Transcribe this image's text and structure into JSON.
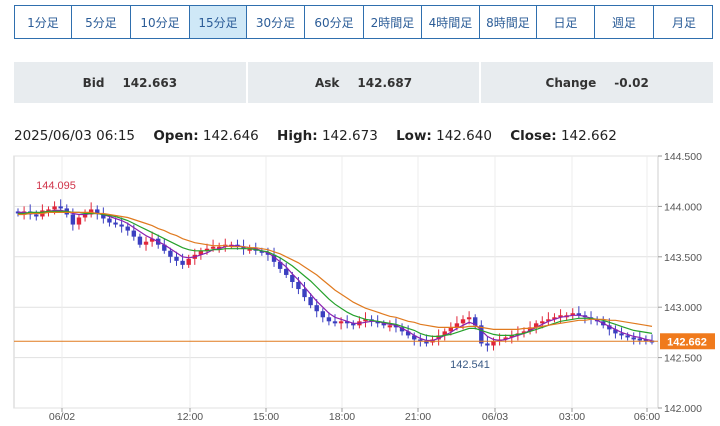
{
  "timeframe_tabs": [
    {
      "label": "1分足",
      "active": false
    },
    {
      "label": "5分足",
      "active": false
    },
    {
      "label": "10分足",
      "active": false
    },
    {
      "label": "15分足",
      "active": true
    },
    {
      "label": "30分足",
      "active": false
    },
    {
      "label": "60分足",
      "active": false
    },
    {
      "label": "2時間足",
      "active": false
    },
    {
      "label": "4時間足",
      "active": false
    },
    {
      "label": "8時間足",
      "active": false
    },
    {
      "label": "日足",
      "active": false
    },
    {
      "label": "週足",
      "active": false
    },
    {
      "label": "月足",
      "active": false
    }
  ],
  "quote": {
    "bid_label": "Bid",
    "bid_value": "142.663",
    "ask_label": "Ask",
    "ask_value": "142.687",
    "change_label": "Change",
    "change_value": "-0.02"
  },
  "ohlc": {
    "timestamp": "2025/06/03 06:15",
    "open_label": "Open:",
    "open_value": "142.646",
    "high_label": "High:",
    "high_value": "142.673",
    "low_label": "Low:",
    "low_value": "142.640",
    "close_label": "Close:",
    "close_value": "142.662"
  },
  "colors": {
    "tab_border": "#2f6fae",
    "tab_text": "#2b5c97",
    "tab_active_bg": "#cfe8f7",
    "quote_bg": "#e8ecef",
    "candle_up": "#e0263a",
    "candle_down": "#3b3fc0",
    "ma_short": "#8a1fb0",
    "ma_mid": "#25a12b",
    "ma_long": "#e07a1f",
    "price_badge": "#f07a1c",
    "annotation": "#d0344a",
    "annotation_low": "#3a5a85"
  },
  "chart_data": {
    "type": "candlestick",
    "y_axis_ticks": [
      "144.500",
      "144.000",
      "143.500",
      "143.000",
      "142.500",
      "142.000"
    ],
    "ylim": [
      142.0,
      144.5
    ],
    "x_axis_ticks": [
      "06/02",
      "12:00",
      "15:00",
      "18:00",
      "21:00",
      "06/03",
      "03:00",
      "06:00"
    ],
    "current_price": "142.662",
    "annotations": {
      "high": "144.095",
      "low": "142.541"
    },
    "grid": true,
    "series": [
      {
        "name": "price",
        "values": [
          143.93,
          143.95,
          143.92,
          143.9,
          143.96,
          143.97,
          144.0,
          143.98,
          143.92,
          143.82,
          143.89,
          143.92,
          143.97,
          143.93,
          143.88,
          143.84,
          143.82,
          143.8,
          143.76,
          143.7,
          143.62,
          143.65,
          143.68,
          143.62,
          143.56,
          143.5,
          143.46,
          143.42,
          143.48,
          143.52,
          143.56,
          143.58,
          143.6,
          143.6,
          143.62,
          143.62,
          143.6,
          143.58,
          143.58,
          143.56,
          143.54,
          143.52,
          143.45,
          143.38,
          143.32,
          143.25,
          143.18,
          143.1,
          143.02,
          142.96,
          142.9,
          142.86,
          142.84,
          142.86,
          142.84,
          142.82,
          142.86,
          142.88,
          142.86,
          142.84,
          142.82,
          142.82,
          142.8,
          142.76,
          142.72,
          142.68,
          142.66,
          142.65,
          142.68,
          142.72,
          142.76,
          142.8,
          142.84,
          142.88,
          142.9,
          142.82,
          142.64,
          142.62,
          142.66,
          142.68,
          142.7,
          142.72,
          142.74,
          142.76,
          142.8,
          142.84,
          142.86,
          142.88,
          142.9,
          142.92,
          142.92,
          142.94,
          142.92,
          142.9,
          142.88,
          142.86,
          142.82,
          142.78,
          142.74,
          142.72,
          142.7,
          142.69,
          142.68,
          142.67,
          142.66
        ]
      },
      {
        "name": "ma_short",
        "values": [
          143.94,
          143.94,
          143.93,
          143.93,
          143.94,
          143.95,
          143.96,
          143.96,
          143.95,
          143.93,
          143.92,
          143.92,
          143.93,
          143.93,
          143.92,
          143.9,
          143.88,
          143.86,
          143.83,
          143.79,
          143.75,
          143.71,
          143.68,
          143.65,
          143.62,
          143.58,
          143.54,
          143.5,
          143.49,
          143.5,
          143.52,
          143.54,
          143.57,
          143.58,
          143.6,
          143.61,
          143.61,
          143.6,
          143.59,
          143.58,
          143.56,
          143.54,
          143.5,
          143.45,
          143.4,
          143.33,
          143.27,
          143.2,
          143.13,
          143.06,
          143.0,
          142.94,
          142.9,
          142.88,
          142.86,
          142.84,
          142.84,
          142.85,
          142.86,
          142.86,
          142.84,
          142.83,
          142.82,
          142.79,
          142.76,
          142.72,
          142.69,
          142.67,
          142.67,
          142.69,
          142.72,
          142.75,
          142.79,
          142.82,
          142.85,
          142.83,
          142.77,
          142.71,
          142.68,
          142.67,
          142.68,
          142.7,
          142.72,
          142.74,
          142.77,
          142.8,
          142.83,
          142.86,
          142.88,
          142.9,
          142.91,
          142.92,
          142.92,
          142.91,
          142.89,
          142.87,
          142.84,
          142.81,
          142.78,
          142.75,
          142.73,
          142.71,
          142.7,
          142.68,
          142.67
        ]
      },
      {
        "name": "ma_mid",
        "values": [
          143.93,
          143.93,
          143.94,
          143.94,
          143.94,
          143.95,
          143.95,
          143.95,
          143.95,
          143.94,
          143.94,
          143.93,
          143.93,
          143.93,
          143.92,
          143.91,
          143.9,
          143.88,
          143.86,
          143.83,
          143.8,
          143.77,
          143.74,
          143.71,
          143.68,
          143.65,
          143.62,
          143.59,
          143.57,
          143.56,
          143.56,
          143.56,
          143.57,
          143.57,
          143.58,
          143.58,
          143.58,
          143.58,
          143.58,
          143.57,
          143.56,
          143.55,
          143.52,
          143.49,
          143.45,
          143.41,
          143.36,
          143.31,
          143.26,
          143.2,
          143.14,
          143.08,
          143.03,
          142.99,
          142.95,
          142.92,
          142.9,
          142.88,
          142.87,
          142.86,
          142.85,
          142.84,
          142.83,
          142.81,
          142.79,
          142.77,
          142.74,
          142.72,
          142.71,
          142.71,
          142.72,
          142.73,
          142.75,
          142.77,
          142.79,
          142.79,
          142.77,
          142.75,
          142.73,
          142.72,
          142.72,
          142.72,
          142.73,
          142.74,
          142.76,
          142.78,
          142.8,
          142.82,
          142.84,
          142.86,
          142.87,
          142.88,
          142.89,
          142.89,
          142.89,
          142.88,
          142.87,
          142.85,
          142.83,
          142.81,
          142.79,
          142.77,
          142.76,
          142.75,
          142.74
        ]
      },
      {
        "name": "ma_long",
        "values": [
          143.92,
          143.92,
          143.93,
          143.93,
          143.93,
          143.94,
          143.94,
          143.94,
          143.94,
          143.94,
          143.94,
          143.94,
          143.94,
          143.93,
          143.93,
          143.92,
          143.91,
          143.9,
          143.89,
          143.87,
          143.85,
          143.83,
          143.81,
          143.78,
          143.76,
          143.73,
          143.71,
          143.68,
          143.66,
          143.64,
          143.63,
          143.62,
          143.61,
          143.61,
          143.61,
          143.6,
          143.6,
          143.6,
          143.59,
          143.59,
          143.58,
          143.57,
          143.55,
          143.53,
          143.5,
          143.47,
          143.44,
          143.4,
          143.36,
          143.32,
          143.27,
          143.22,
          143.17,
          143.13,
          143.09,
          143.05,
          143.02,
          142.99,
          142.97,
          142.95,
          142.93,
          142.91,
          142.9,
          142.88,
          142.86,
          142.85,
          142.83,
          142.82,
          142.81,
          142.8,
          142.8,
          142.8,
          142.8,
          142.8,
          142.81,
          142.81,
          142.8,
          142.79,
          142.78,
          142.78,
          142.78,
          142.78,
          142.78,
          142.79,
          142.79,
          142.8,
          142.81,
          142.82,
          142.83,
          142.84,
          142.85,
          142.86,
          142.87,
          142.87,
          142.88,
          142.88,
          142.88,
          142.87,
          142.87,
          142.86,
          142.85,
          142.84,
          142.83,
          142.82,
          142.81
        ]
      }
    ]
  }
}
